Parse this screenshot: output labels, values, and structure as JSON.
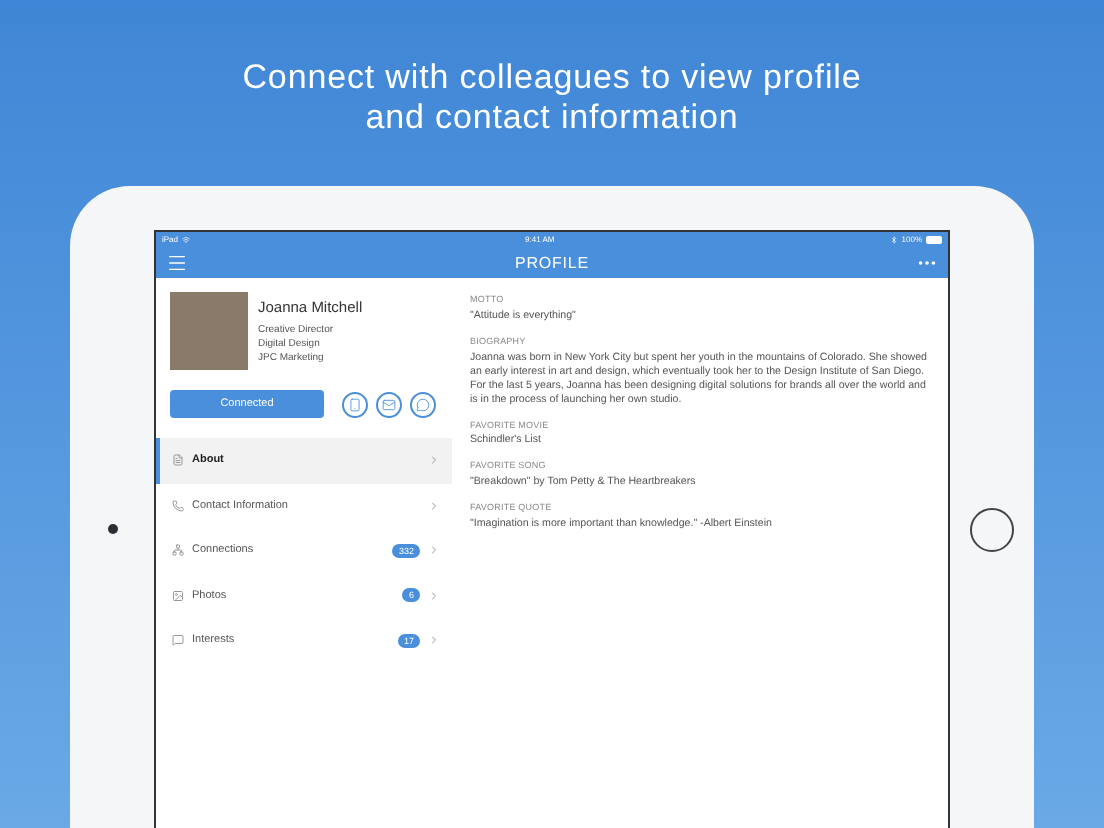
{
  "headline": [
    "Connect with colleagues to view profile",
    "and contact information"
  ],
  "status_bar": {
    "carrier": "iPad",
    "time": "9:41 AM",
    "battery": "100%"
  },
  "nav": {
    "title": "PROFILE"
  },
  "profile": {
    "name": "Joanna Mitchell",
    "lines": [
      "Creative Director",
      "Digital Design",
      "JPC Marketing"
    ],
    "button": "Connected"
  },
  "menu": [
    {
      "kind": "about",
      "label": "About",
      "selected": true
    },
    {
      "kind": "contact",
      "label": "Contact Information",
      "selected": false
    },
    {
      "kind": "connections",
      "label": "Connections",
      "badge": "332",
      "selected": false
    },
    {
      "kind": "photos",
      "label": "Photos",
      "badge": "6",
      "selected": false
    },
    {
      "kind": "interests",
      "label": "Interests",
      "badge": "17",
      "selected": false
    }
  ],
  "details": [
    {
      "label": "MOTTO",
      "value": "\"Attitude is everything\""
    },
    {
      "label": "BIOGRAPHY",
      "value": "Joanna was born in New York City but spent her youth in the mountains of Colorado. She showed an early interest in art and design, which eventually took her to the Design Institute of San Diego. For the last 5 years, Joanna has been designing digital solutions for brands all over the world and is in the process of launching her own studio."
    },
    {
      "label": "FAVORITE MOVIE",
      "value": "Schindler's List"
    },
    {
      "label": "FAVORITE SONG",
      "value": "\"Breakdown\" by Tom Petty & The Heartbreakers"
    },
    {
      "label": "FAVORITE QUOTE",
      "value": "\"Imagination is more important than knowledge.\" -Albert Einstein"
    }
  ]
}
